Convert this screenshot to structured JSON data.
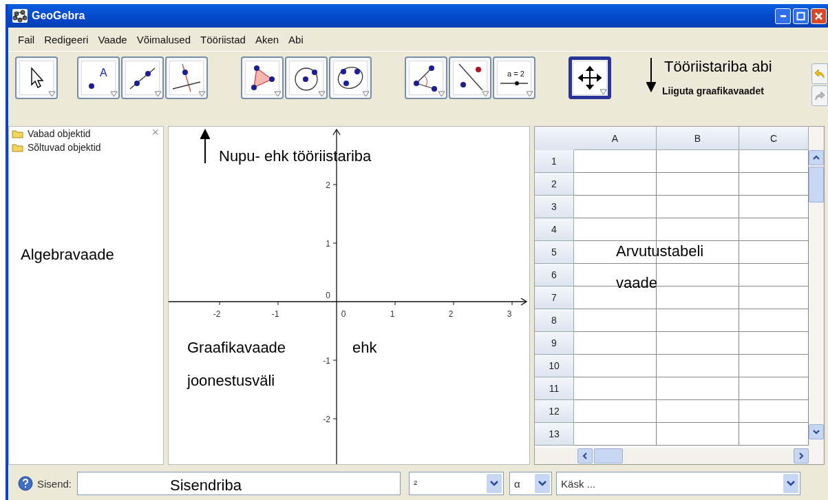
{
  "window": {
    "title": "GeoGebra"
  },
  "menu": [
    "Fail",
    "Redigeeri",
    "Vaade",
    "Võimalused",
    "Tööriistad",
    "Aken",
    "Abi"
  ],
  "toolbar": {
    "groups": [
      [
        {
          "kind": "pointer",
          "selected": false
        }
      ],
      [
        {
          "kind": "point",
          "selected": false,
          "caption": "A"
        },
        {
          "kind": "line",
          "selected": false
        },
        {
          "kind": "perpendicular",
          "selected": false
        }
      ],
      [
        {
          "kind": "polygon",
          "selected": false
        },
        {
          "kind": "circle",
          "selected": false
        },
        {
          "kind": "conic",
          "selected": false
        }
      ],
      [
        {
          "kind": "angle",
          "selected": false
        },
        {
          "kind": "reflect",
          "selected": false
        },
        {
          "kind": "slider",
          "selected": false,
          "caption": "a = 2"
        }
      ],
      [
        {
          "kind": "move-view",
          "selected": true
        }
      ]
    ],
    "help": "Liiguta graafikavaadet"
  },
  "algebra": {
    "folders": [
      "Vabad objektid",
      "Sõltuvad objektid"
    ],
    "close": "×"
  },
  "graphics": {
    "x_labels": [
      "-2",
      "-1",
      "0",
      "1",
      "2",
      "3"
    ],
    "y_labels": [
      "2",
      "1",
      "0",
      "-1",
      "-2"
    ]
  },
  "spreadsheet": {
    "columns": [
      "A",
      "B",
      "C"
    ],
    "rows": [
      "1",
      "2",
      "3",
      "4",
      "5",
      "6",
      "7",
      "8",
      "9",
      "10",
      "11",
      "12",
      "13"
    ]
  },
  "input_bar": {
    "label": "Sisend:",
    "symbol": "²",
    "greek": "α",
    "command": "Käsk ..."
  },
  "annotations": [
    {
      "text": "Tööriistariba abi",
      "kind": "pointing_down"
    },
    {
      "text": "Nupu- ehk tööriistariba",
      "kind": "pointing_up"
    },
    {
      "text": "Algebravaade",
      "kind": "plain"
    },
    {
      "text": "Arvutustabeli",
      "kind": "plain"
    },
    {
      "text": "vaade",
      "kind": "plain"
    },
    {
      "text": "Graafikavaade",
      "kind": "plain"
    },
    {
      "text": "ehk",
      "kind": "plain"
    },
    {
      "text": "joonestusväli",
      "kind": "plain"
    },
    {
      "text": "Sisendriba",
      "kind": "plain"
    }
  ]
}
